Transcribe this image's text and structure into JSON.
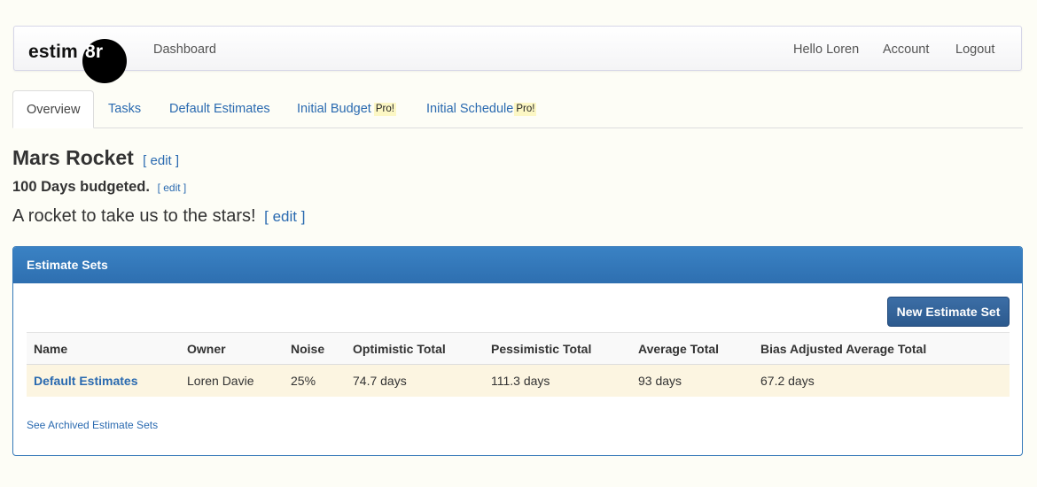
{
  "navbar": {
    "brand_text": "estim",
    "brand_ball_text": "8r",
    "dashboard": "Dashboard",
    "greeting": "Hello Loren",
    "account": "Account",
    "logout": "Logout"
  },
  "tabs": [
    {
      "label": "Overview",
      "active": true
    },
    {
      "label": "Tasks"
    },
    {
      "label": "Default Estimates"
    },
    {
      "label": "Initial Budget",
      "badge": "Pro!"
    },
    {
      "label": "Initial Schedule",
      "badge": "Pro!"
    }
  ],
  "project": {
    "title": "Mars Rocket",
    "title_edit": "[ edit ]",
    "budget": "100 Days budgeted.",
    "budget_edit": "[ edit ]",
    "description": "A rocket to take us to the stars!",
    "description_edit": "[ edit ]"
  },
  "panel": {
    "heading": "Estimate Sets",
    "new_button": "New Estimate Set",
    "columns": [
      "Name",
      "Owner",
      "Noise",
      "Optimistic Total",
      "Pessimistic Total",
      "Average Total",
      "Bias Adjusted Average Total"
    ],
    "rows": [
      [
        "Default Estimates",
        "Loren Davie",
        "25%",
        "74.7 days",
        "111.3 days",
        "93 days",
        "67.2 days"
      ]
    ],
    "archived_link": "See Archived Estimate Sets"
  },
  "colors": {
    "accent": "#2a6ab0",
    "panel_header": "#3478b8",
    "row_highlight": "#fcf5e1",
    "pro_badge": "#fcf7c4"
  }
}
